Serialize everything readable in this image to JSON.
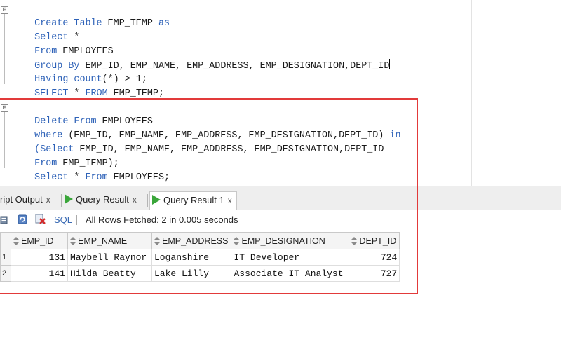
{
  "editor": {
    "block1": {
      "line1": [
        "Create Table",
        " EMP_TEMP ",
        "as"
      ],
      "line2": [
        "Select",
        " *"
      ],
      "line3": [
        "From",
        " EMPLOYEES"
      ],
      "line4": [
        "Group By",
        " EMP_ID, EMP_NAME, EMP_ADDRESS, EMP_DESIGNATION,DEPT_ID"
      ],
      "line5": [
        "Having",
        " ",
        "count",
        "(*) > 1;"
      ],
      "line6": [
        "SELECT",
        " * ",
        "FROM",
        " EMP_TEMP;"
      ]
    },
    "block2": {
      "line1": [
        "Delete From",
        " EMPLOYEES"
      ],
      "line2": [
        "where",
        " (EMP_ID, EMP_NAME, EMP_ADDRESS, EMP_DESIGNATION,DEPT_ID) ",
        "in"
      ],
      "line3": [
        "(Select",
        " EMP_ID, EMP_NAME, EMP_ADDRESS, EMP_DESIGNATION,DEPT_ID"
      ],
      "line4": [
        "From",
        " EMP_TEMP);"
      ],
      "line5": [
        "Select",
        " * ",
        "From",
        " EMPLOYEES;"
      ]
    },
    "fold_symbol": "⊟"
  },
  "panel": {
    "tabs": [
      {
        "label": "ript Output",
        "close": "x"
      },
      {
        "label": "Query Result",
        "close": "x"
      },
      {
        "label": "Query Result 1",
        "close": "x"
      }
    ],
    "toolbar": {
      "sql_label": "SQL",
      "status": "All Rows Fetched: 2 in 0.005 seconds"
    },
    "grid": {
      "columns": [
        "EMP_ID",
        "EMP_NAME",
        "EMP_ADDRESS",
        "EMP_DESIGNATION",
        "DEPT_ID"
      ],
      "rows": [
        {
          "n": "1",
          "EMP_ID": "131",
          "EMP_NAME": "Maybell Raynor",
          "EMP_ADDRESS": "Loganshire",
          "EMP_DESIGNATION": "IT Developer",
          "DEPT_ID": "724"
        },
        {
          "n": "2",
          "EMP_ID": "141",
          "EMP_NAME": "Hilda Beatty",
          "EMP_ADDRESS": "Lake Lilly",
          "EMP_DESIGNATION": "Associate IT Analyst",
          "DEPT_ID": "727"
        }
      ]
    }
  },
  "colors": {
    "keyword": "#2e62b8",
    "highlight_box": "#e23a3a",
    "run_icon": "#3aa63a"
  },
  "icons": [
    "fold-minus-icon",
    "play-icon",
    "pin-icon",
    "refresh-icon",
    "clear-icon",
    "sort-icon"
  ]
}
